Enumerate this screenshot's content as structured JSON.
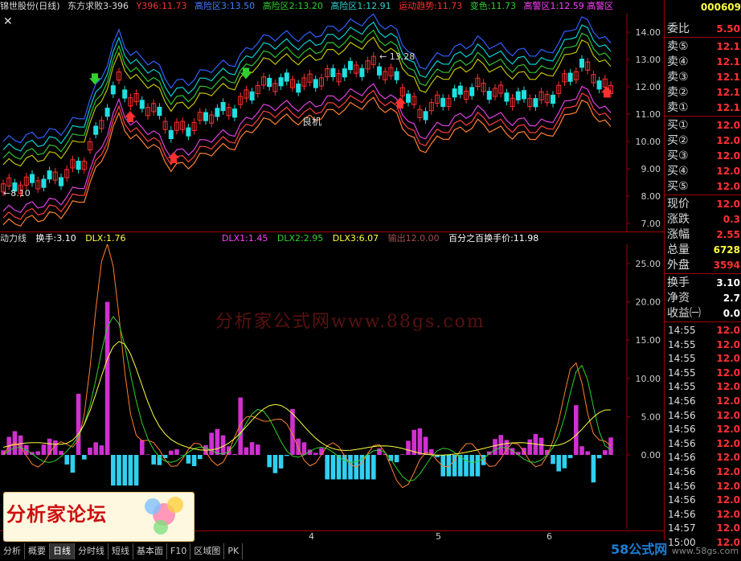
{
  "topbar": {
    "title": "锦世股份(日线)",
    "indicator": "东方求败3-396",
    "y396": "Y396:11.73",
    "gaoxian1": "高险区3:13.50",
    "gaoxian2": "高险区2:13.20",
    "gaoxian3": "高险区1:12.91",
    "yundong": "运动趋势:11.73",
    "bianse": "变色:11.73",
    "trailing": "高警区1:12.59 高警区"
  },
  "topright_code": "000609",
  "main": {
    "yaxis": [
      "14.00",
      "13.00",
      "12.00",
      "11.00",
      "10.00",
      "9.00",
      "8.00",
      "7.00"
    ],
    "annot_high": "13.28",
    "annot_low": "8.10",
    "annot_liangji": "良机",
    "colors": {
      "up": "#ff3030",
      "down": "#20e0e0",
      "band_blue": "#3060ff",
      "band_cyan": "#00d0d0",
      "band_green": "#30c030",
      "band_yellow": "#c0c000",
      "band_magenta": "#e040e0",
      "band_red": "#ff4040",
      "band_orange": "#ff8030"
    }
  },
  "sub": {
    "name": "动力线",
    "huanshou": "换手:3.10",
    "dlx": "DLX:1.76",
    "dlx1": "DLX1:1.45",
    "dlx2": "DLX2:2.95",
    "dlx3": "DLX3:6.07",
    "shuchu": "输出12.0.00",
    "baifen": "百分之百换手价:11.98",
    "yaxis": [
      "25.00",
      "20.00",
      "15.00",
      "10.00",
      "5.00",
      "0.00"
    ],
    "watermark": "分析家公式网www.88gs.com"
  },
  "xaxis": [
    "4",
    "5",
    "6"
  ],
  "tabs": [
    "分析",
    "概要",
    "日线",
    "分时线",
    "短线",
    "基本面",
    "F10",
    "区域图",
    "PK"
  ],
  "logo": "分析家论坛",
  "footer": {
    "brand": "58公式网",
    "url": "www.58gs.com"
  },
  "quote": {
    "weibi_label": "委比",
    "weibi_val": "5.50",
    "sell": [
      {
        "l": "卖⑤",
        "v": "12.1"
      },
      {
        "l": "卖④",
        "v": "12.1"
      },
      {
        "l": "卖③",
        "v": "12.1"
      },
      {
        "l": "卖②",
        "v": "12.1"
      },
      {
        "l": "卖①",
        "v": "12.1"
      }
    ],
    "buy": [
      {
        "l": "买①",
        "v": "12.0"
      },
      {
        "l": "买②",
        "v": "12.0"
      },
      {
        "l": "买③",
        "v": "12.0"
      },
      {
        "l": "买④",
        "v": "12.0"
      },
      {
        "l": "买⑤",
        "v": "12.0"
      }
    ],
    "stats": [
      {
        "l": "现价",
        "v": "12.0",
        "c": "#ff3030"
      },
      {
        "l": "涨跌",
        "v": "0.3",
        "c": "#ff3030"
      },
      {
        "l": "涨幅",
        "v": "2.55",
        "c": "#ff3030"
      },
      {
        "l": "总量",
        "v": "6728",
        "c": "#ffff40"
      },
      {
        "l": "外盘",
        "v": "3594",
        "c": "#ff3030"
      }
    ],
    "stats2": [
      {
        "l": "换手",
        "v": "3.10",
        "c": "#ffffff"
      },
      {
        "l": "净资",
        "v": "2.7",
        "c": "#ffffff"
      },
      {
        "l": "收益㈠",
        "v": "0.0",
        "c": "#ffffff"
      }
    ],
    "ticks": [
      {
        "t": "14:55",
        "p": "12.0"
      },
      {
        "t": "14:55",
        "p": "12.0"
      },
      {
        "t": "14:55",
        "p": "12.0"
      },
      {
        "t": "14:55",
        "p": "12.0"
      },
      {
        "t": "14:55",
        "p": "12.0"
      },
      {
        "t": "14:56",
        "p": "12.0"
      },
      {
        "t": "14:56",
        "p": "12.0"
      },
      {
        "t": "14:56",
        "p": "12.0"
      },
      {
        "t": "14:56",
        "p": "12.0"
      },
      {
        "t": "14:56",
        "p": "12.0"
      },
      {
        "t": "14:56",
        "p": "12.0"
      },
      {
        "t": "14:56",
        "p": "12.0"
      },
      {
        "t": "14:56",
        "p": "12.0"
      },
      {
        "t": "14:56",
        "p": "12.0"
      },
      {
        "t": "14:57",
        "p": "12.0"
      },
      {
        "t": "15:00",
        "p": "12.0"
      }
    ]
  }
}
